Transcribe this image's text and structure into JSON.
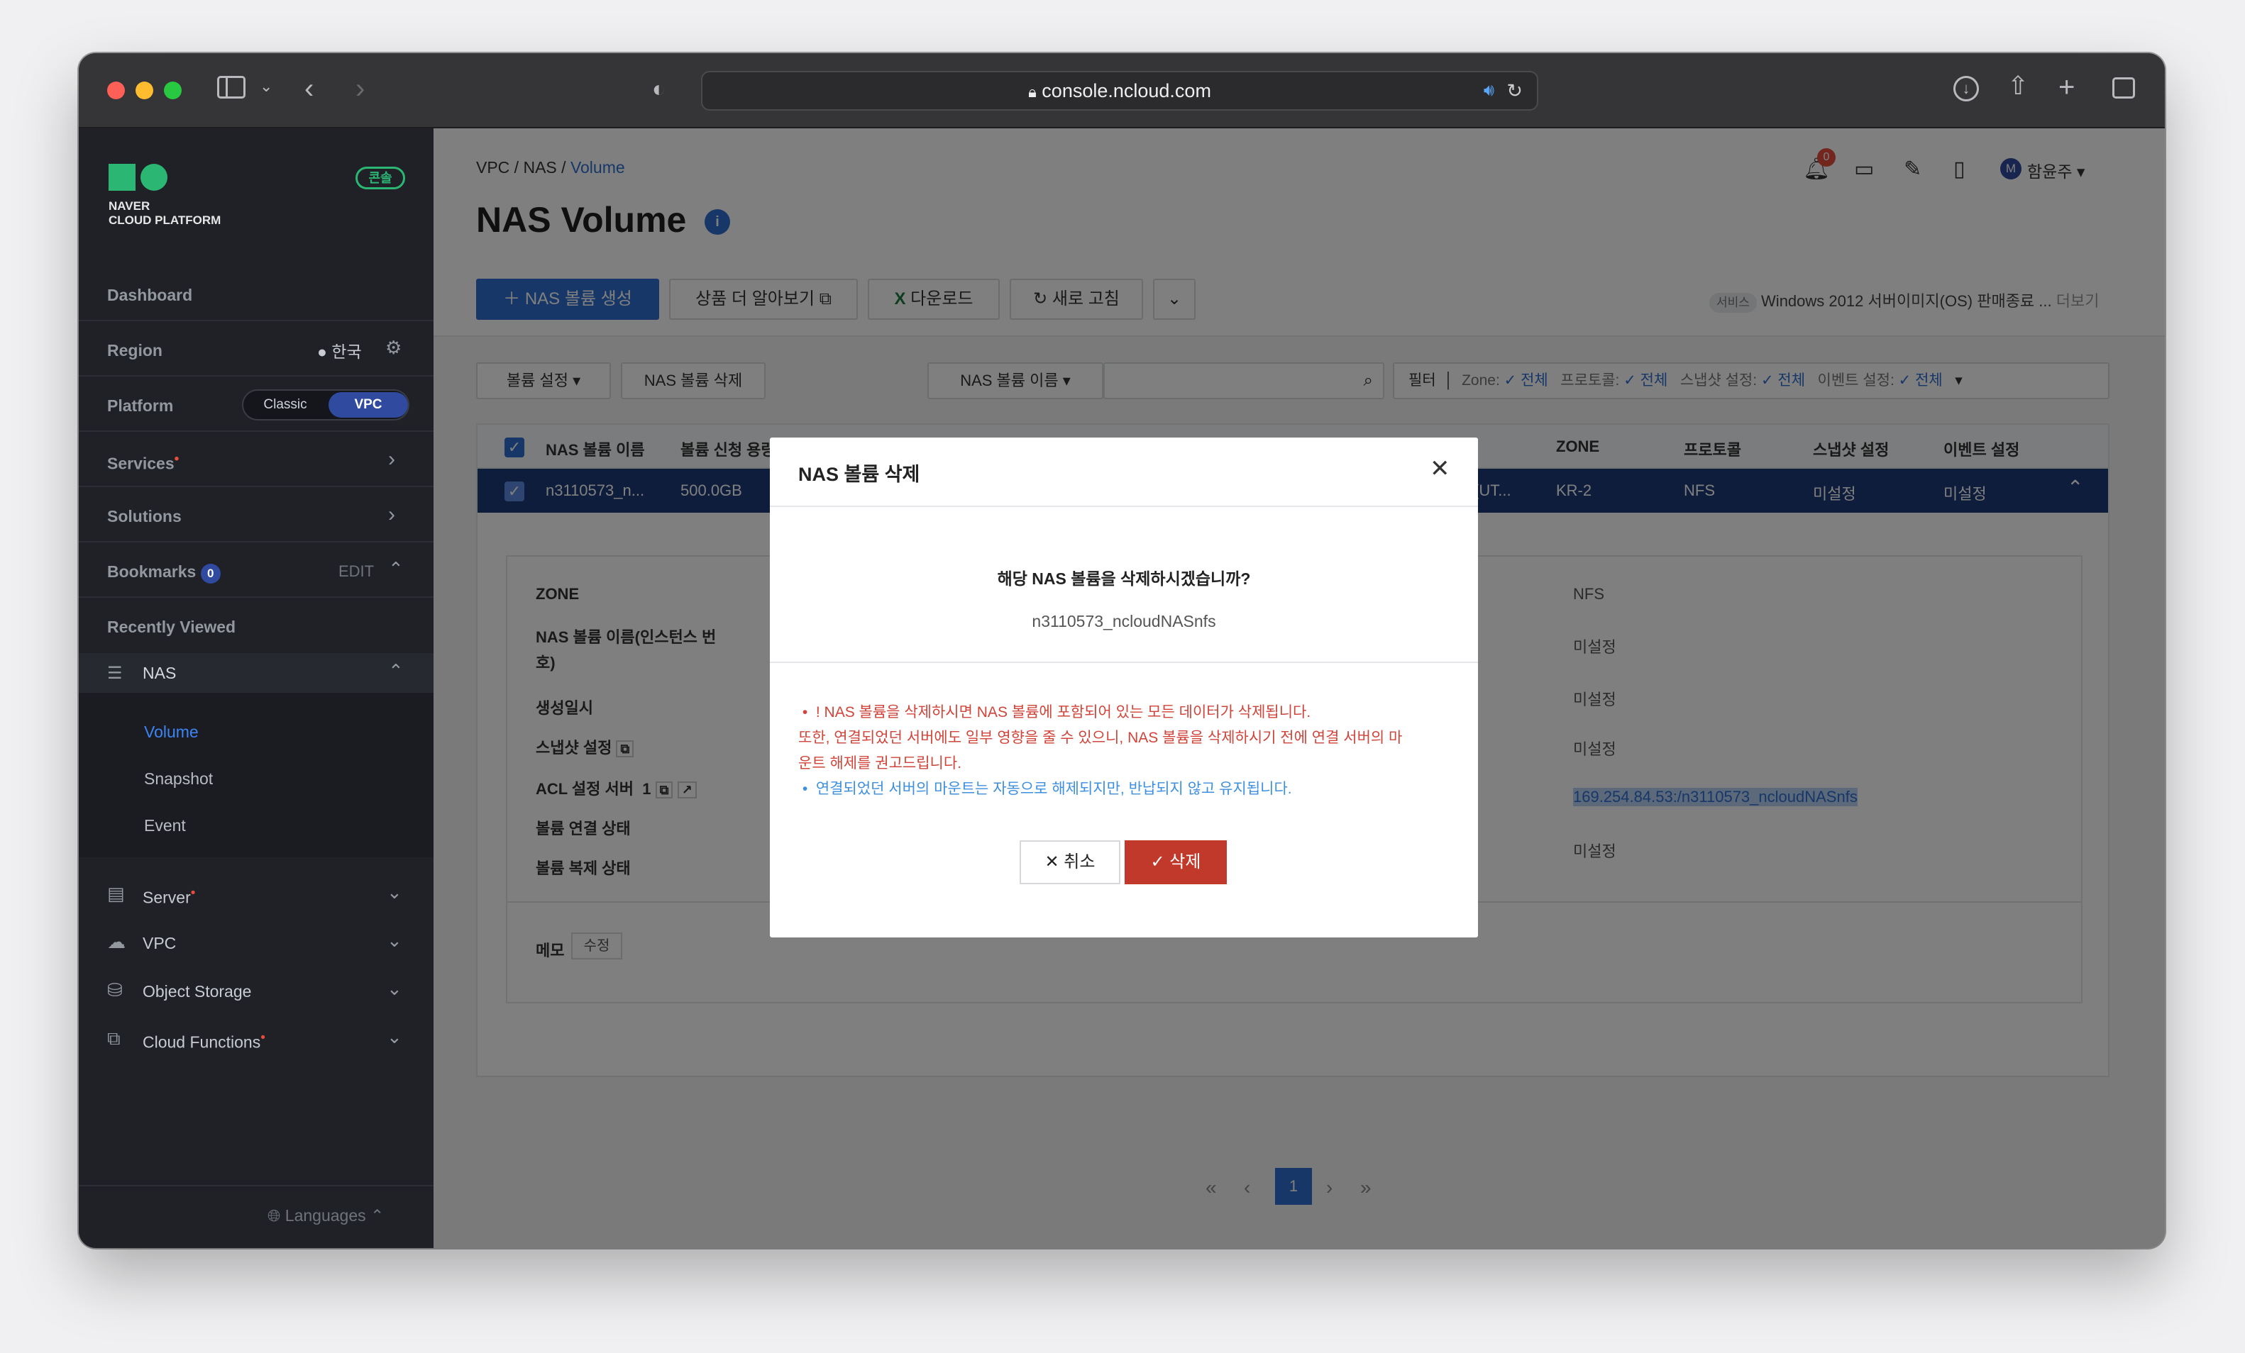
{
  "browser": {
    "url": "console.ncloud.com"
  },
  "brand": {
    "line1": "NAVER",
    "line2": "CLOUD PLATFORM",
    "badge": "콘솔"
  },
  "sidebar": {
    "dashboard": "Dashboard",
    "region_label": "Region",
    "region_value": "한국",
    "platform_label": "Platform",
    "platform_classic": "Classic",
    "platform_vpc": "VPC",
    "services": "Services",
    "solutions": "Solutions",
    "bookmarks": "Bookmarks",
    "bookmarks_count": "0",
    "bookmarks_edit": "EDIT",
    "recently_viewed": "Recently Viewed",
    "nas": "NAS",
    "nas_sub": [
      "Volume",
      "Snapshot",
      "Event"
    ],
    "server": "Server",
    "vpc": "VPC",
    "object_storage": "Object Storage",
    "cloud_functions": "Cloud Functions",
    "languages": "Languages"
  },
  "breadcrumb": {
    "a": "VPC",
    "b": "NAS",
    "c": "Volume"
  },
  "page": {
    "title": "NAS Volume",
    "info_badge": "i"
  },
  "header": {
    "bell_count": "0",
    "avatar": "M",
    "user": "함윤주"
  },
  "toolbar": {
    "create": "NAS 볼륨 생성",
    "learn": "상품 더 알아보기",
    "download": "다운로드",
    "refresh": "새로 고침",
    "notice_tag": "서비스",
    "notice_text": "Windows 2012 서버이미지(OS) 판매종료 ...",
    "notice_more": "더보기"
  },
  "filterbar": {
    "volume_settings": "볼륨 설정",
    "delete_volume": "NAS 볼륨 삭제",
    "search_select": "NAS 볼륨 이름",
    "filter": "필터",
    "zone_label": "Zone:",
    "zone_value": "전체",
    "protocol_label": "프로토콜:",
    "protocol_value": "전체",
    "snapshot_label": "스냅샷 설정:",
    "snapshot_value": "전체",
    "event_label": "이벤트 설정:",
    "event_value": "전체"
  },
  "table": {
    "headers": {
      "name": "NAS 볼륨 이름",
      "size": "볼륨 신청 용량",
      "zone": "ZONE",
      "protocol": "프로토콜",
      "snapshot": "스냅샷 설정",
      "event": "이벤트 설정"
    },
    "row": {
      "name": "n3110573_n...",
      "size": "500.0GB",
      "partial": "(UT...",
      "zone": "KR-2",
      "protocol": "NFS",
      "snapshot": "미설정",
      "event": "미설정"
    }
  },
  "detail": {
    "zone": "ZONE",
    "vol_name_line1": "NAS 볼륨 이름(인스턴스 번",
    "vol_name_line2": "호)",
    "created": "생성일시",
    "snapshot_setting": "스냅샷 설정",
    "acl": "ACL 설정 서버",
    "acl_count": "1",
    "link_status": "볼륨 연결 상태",
    "replica_status": "볼륨 복제 상태",
    "right_values": [
      "NFS",
      "미설정",
      "미설정",
      "미설정",
      "169.254.84.53:/n3110573_ncloudNASnfs",
      "미설정"
    ],
    "memo": "메모",
    "memo_edit": "수정"
  },
  "pagination": {
    "current": "1"
  },
  "modal": {
    "title": "NAS 볼륨 삭제",
    "question": "해당 NAS 볼륨을 삭제하시겠습니까?",
    "volume": "n3110573_ncloudNASnfs",
    "warn1": "! NAS 볼륨을 삭제하시면 NAS 볼륨에 포함되어 있는 모든 데이터가 삭제됩니다.",
    "warn2": "또한, 연결되었던 서버에도 일부 영향을 줄 수 있으니, NAS 볼륨을 삭제하시기 전에 연결 서버의 마",
    "warn3": "운트 해제를 권고드립니다.",
    "info": "연결되었던 서버의 마운트는 자동으로 해제되지만, 반납되지 않고 유지됩니다.",
    "cancel": "취소",
    "confirm": "삭제"
  },
  "colors": {
    "primary": "#2f6fd1",
    "danger": "#c0392b",
    "sidebar": "#1f2127",
    "accent_green": "#2bb673"
  }
}
